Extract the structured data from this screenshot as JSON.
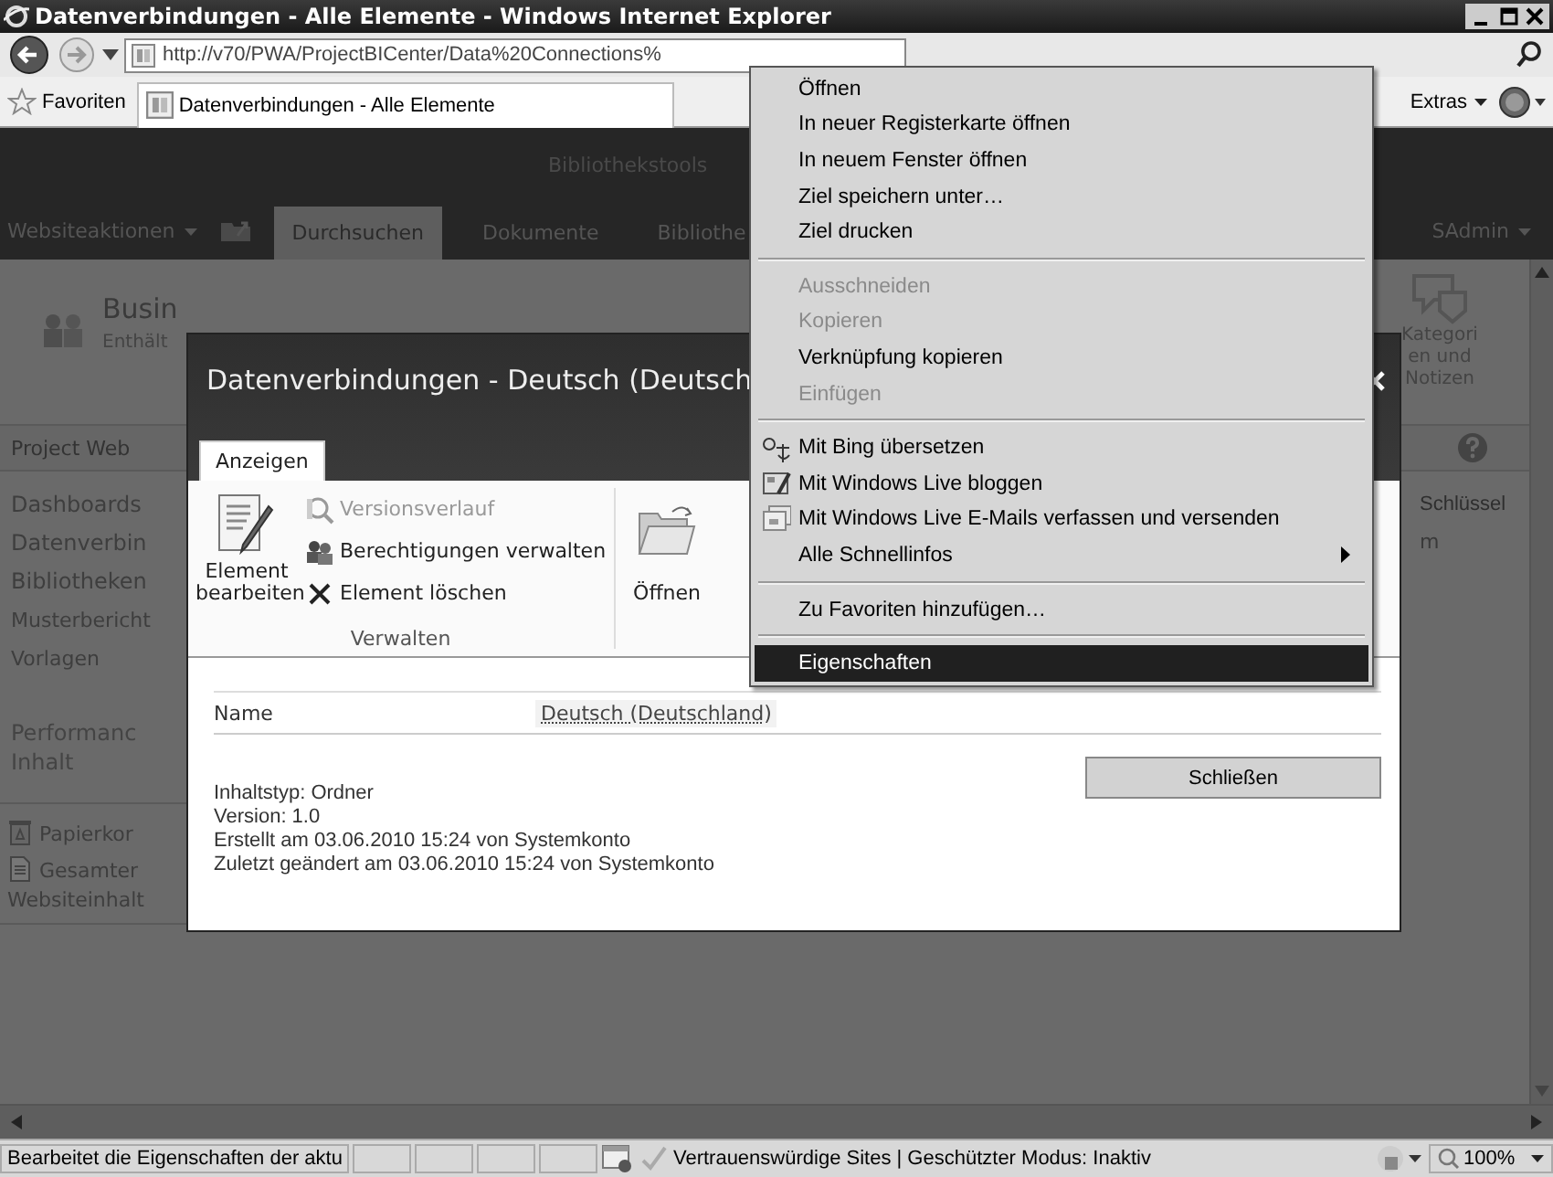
{
  "window": {
    "title": "Datenverbindungen - Alle Elemente - Windows Internet Explorer"
  },
  "address_bar": {
    "url": "http://v70/PWA/ProjectBICenter/Data%20Connections%"
  },
  "favorites_bar": {
    "favorites": "Favoriten",
    "tab": "Datenverbindungen - Alle Elemente",
    "tools": "Extras"
  },
  "ribbon": {
    "group_label": "Bibliothekstools",
    "site_actions": "Websiteaktionen",
    "user": "SAdmin",
    "tabs": [
      {
        "label": "Durchsuchen",
        "selected": true
      },
      {
        "label": "Dokumente",
        "selected": false
      },
      {
        "label": "Bibliothe",
        "selected": false
      }
    ]
  },
  "page": {
    "title": "Busin",
    "subtitle": "Enthält",
    "breadcrumb": "Project Web",
    "tag_button": "Kategorien und Notizen",
    "right_heading": "Schlüssel",
    "right_fragment": "m",
    "nav": [
      {
        "label": "Dashboards",
        "kind": "link"
      },
      {
        "label": "Datenverbin",
        "kind": "link"
      },
      {
        "label": "Bibliotheken",
        "kind": "link"
      },
      {
        "label": "Musterbericht",
        "kind": "small"
      },
      {
        "label": "Vorlagen",
        "kind": "small"
      },
      {
        "label": "Performanc",
        "kind": "heading"
      },
      {
        "label": "Inhalt",
        "kind": "heading"
      }
    ],
    "bottom_links": [
      {
        "label": "Papierkor"
      },
      {
        "label": "Gesamter Websiteinhalt"
      }
    ]
  },
  "dialog": {
    "title": "Datenverbindungen - Deutsch (Deutsch",
    "tabs": [
      {
        "label": "Anzeigen",
        "selected": true
      }
    ],
    "commands": [
      {
        "label": "Element bearbeiten",
        "kind": "large",
        "disabled": false
      },
      {
        "label": "Versionsverlauf",
        "kind": "small",
        "disabled": true
      },
      {
        "label": "Berechtigungen verwalten",
        "kind": "small",
        "disabled": false
      },
      {
        "label": "Element löschen",
        "kind": "small",
        "disabled": false
      },
      {
        "label": "Öffnen",
        "kind": "open",
        "disabled": false
      }
    ],
    "group_label": "Verwalten",
    "fields": [
      {
        "label": "Name",
        "value": "Deutsch (Deutschland)"
      }
    ],
    "info": [
      "Inhaltstyp: Ordner",
      "Version: 1.0",
      "Erstellt am 03.06.2010 15:24 von Systemkonto",
      "Zuletzt geändert am 03.06.2010 15:24 von Systemkonto"
    ],
    "close_button": "Schließen"
  },
  "context_menu": [
    {
      "kind": "item",
      "label": "Öffnen",
      "disabled": false,
      "selected": false
    },
    {
      "kind": "item",
      "label": "In neuer Registerkarte öffnen",
      "disabled": false,
      "selected": false
    },
    {
      "kind": "item",
      "label": "In neuem Fenster öffnen",
      "disabled": false,
      "selected": false
    },
    {
      "kind": "item",
      "label": "Ziel speichern unter…",
      "disabled": false,
      "selected": false
    },
    {
      "kind": "item",
      "label": "Ziel drucken",
      "disabled": false,
      "selected": false
    },
    {
      "kind": "separator"
    },
    {
      "kind": "item",
      "label": "Ausschneiden",
      "disabled": true,
      "selected": false
    },
    {
      "kind": "item",
      "label": "Kopieren",
      "disabled": true,
      "selected": false
    },
    {
      "kind": "item",
      "label": "Verknüpfung kopieren",
      "disabled": false,
      "selected": false
    },
    {
      "kind": "item",
      "label": "Einfügen",
      "disabled": true,
      "selected": false
    },
    {
      "kind": "separator"
    },
    {
      "kind": "icon-item",
      "label": "Mit Bing übersetzen",
      "disabled": false,
      "selected": false
    },
    {
      "kind": "icon-item",
      "label": "Mit Windows Live bloggen",
      "disabled": false,
      "selected": false
    },
    {
      "kind": "icon-item",
      "label": "Mit Windows Live E-Mails verfassen und versenden",
      "disabled": false,
      "selected": false
    },
    {
      "kind": "submenu",
      "label": "Alle Schnellinfos",
      "disabled": false,
      "selected": false
    },
    {
      "kind": "separator"
    },
    {
      "kind": "item",
      "label": "Zu Favoriten hinzufügen…",
      "disabled": false,
      "selected": false
    },
    {
      "kind": "separator"
    },
    {
      "kind": "item",
      "label": "Eigenschaften",
      "disabled": false,
      "selected": true
    }
  ],
  "status_bar": {
    "text": "Bearbeitet die Eigenschaften der aktu",
    "zone": "Vertrauenswürdige Sites | Geschützter Modus: Inaktiv",
    "zoom": "100%"
  }
}
